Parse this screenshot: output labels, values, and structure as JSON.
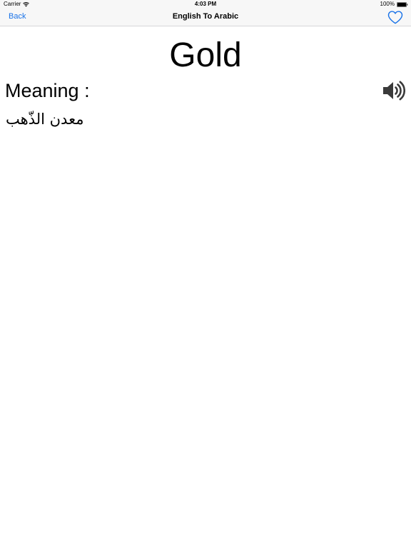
{
  "status_bar": {
    "carrier": "Carrier",
    "time": "4:03 PM",
    "battery": "100%"
  },
  "nav_bar": {
    "back_label": "Back",
    "title": "English To Arabic",
    "favorite_icon": "heart-outline-icon"
  },
  "entry": {
    "word": "Gold",
    "meaning_label": "Meaning :",
    "meaning": "معدن الذّهب",
    "speaker_icon": "speaker-icon"
  },
  "colors": {
    "accent": "#1a73e8",
    "bar_background": "#f7f7f7",
    "speaker": "#3a3a3a"
  }
}
